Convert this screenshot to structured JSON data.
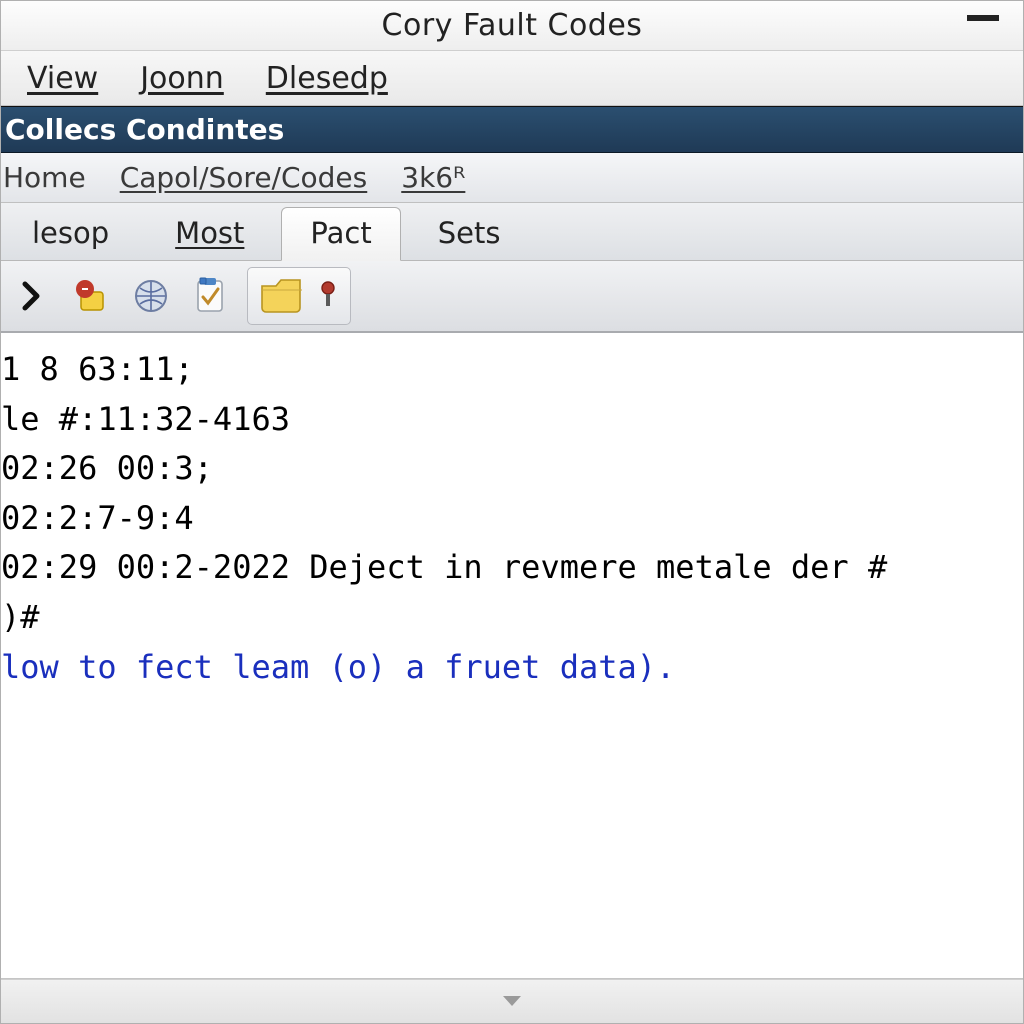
{
  "window": {
    "title": "Cory Fault Codes"
  },
  "menu": {
    "view": "View",
    "joonn": "Joonn",
    "dlesedp": "Dlesedp"
  },
  "banner": {
    "text": "Collecs Condintes"
  },
  "submenu": {
    "home": "Home",
    "capol": "Capol/Sore/Codes",
    "k36": "3k6ᴿ"
  },
  "tabs": {
    "t0": "lesop",
    "t1": "Most",
    "t2": "Pact",
    "t3": "Sets",
    "activeIndex": 2
  },
  "toolbar": {
    "icons": [
      "chevron-right",
      "alert-badge",
      "globe",
      "clipboard-check",
      "folder",
      "record-dot"
    ]
  },
  "log": {
    "l0": "1 8 63:11;",
    "l1": "le #:11:32-4163",
    "l2": "",
    "l3": "02:26 00:3;",
    "l4": "02:2:7-9:4",
    "l5": "02:29 00:2-2022 Deject in revmere metale der #",
    "l6": "",
    "l7": ")#",
    "l8": "",
    "l9": "low to fect leam (o) a fruet data)."
  },
  "colors": {
    "banner_bg": "#23456a",
    "link": "#1a2fbd"
  }
}
